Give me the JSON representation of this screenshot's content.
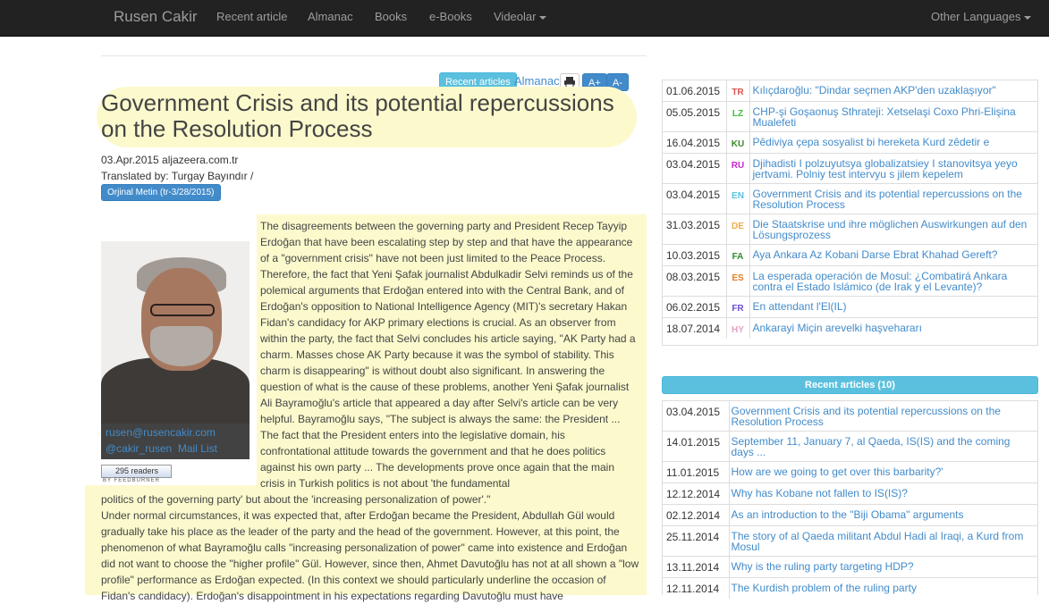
{
  "nav": {
    "brand": "Rusen Cakir",
    "items": [
      "Recent article",
      "Almanac",
      "Books",
      "e-Books",
      "Videolar"
    ],
    "other_languages": "Other Languages"
  },
  "toolbar": {
    "recent_articles": "Recent articles",
    "almanac": "Almanac",
    "print_icon": "print-icon",
    "font_increase": "A+",
    "font_decrease": "A-"
  },
  "article": {
    "title": "Government Crisis and its potential repercussions on the Resolution Process",
    "date_source": "03.Apr.2015 aljazeera.com.tr",
    "translated_by": "Translated by: Turgay Bayındır /",
    "original_button": "Orjinal Metin (tr-3/28/2015)",
    "para1": "The disagreements between the governing party and President Recep Tayyip Erdoğan that have been escalating step by step and that have the appearance of a \"government crisis\" have not been just limited to the Peace Process. Therefore, the fact that Yeni Şafak journalist Abdulkadir Selvi reminds us of the polemical arguments that Erdoğan entered into with the Central Bank, and of Erdoğan's opposition to National Intelligence Agency (MIT)'s secretary Hakan Fidan's candidacy for AKP primary elections is crucial. As an observer from within the party, the fact that Selvi concludes his article saying, \"AK Party had a charm. Masses chose AK Party because it was the symbol of stability. This charm is disappearing\" is without doubt also significant. In answering the question of what is the cause of these problems, another Yeni Şafak journalist Ali Bayramoğlu's article that appeared a day after Selvi's article can be very helpful. Bayramoğlu says, \"The subject is always the same: the President ... The fact that the President enters into the legislative domain, his confrontational attitude towards the government and that he does politics against his own party ... The developments prove once again that the main crisis in Turkish politics is not about 'the fundamental",
    "para1_end": "politics of the governing party' but about the 'increasing personalization of power'.\"",
    "para2": "Under normal circumstances, it was expected that, after Erdoğan became the President, Abdullah Gül would gradually take his place as the leader of the party and the head of the government. However, at this point, the phenomenon of what Bayramoğlu calls \"increasing personalization of power\" came into existence and Erdoğan did not want to choose the \"higher profile\" Gül. However, since then, Ahmet Davutoğlu has not at all shown a \"low profile\" performance as Erdoğan expected. (In this context we should particularly underline the occasion of Fidan's candidacy). Erdoğan's disappointment in his expectations regarding Davutoğlu must have"
  },
  "author": {
    "email": "rusen@rusencakir.com",
    "twitter": "@cakir_rusen",
    "mail_list": "Mail List",
    "feed_count": "295 readers",
    "feed_label": "BY FEEDBURNER"
  },
  "translations": [
    {
      "date": "01.06.2015",
      "lang": "TR",
      "color": "#d9534f",
      "title": "Kılıçdaroğlu: \"Dindar seçmen AKP'den uzaklaşıyor\""
    },
    {
      "date": "05.05.2015",
      "lang": "LZ",
      "color": "#3dbf3d",
      "title": "CHP-şi Goşaonuş Sthrateji: Xetselaşi Coxo Phri-Elişina Mualefeti"
    },
    {
      "date": "16.04.2015",
      "lang": "KU",
      "color": "#3c8a2e",
      "title": "Pêdiviya çepa sosyalist bi hereketa Kurd zêdetir e"
    },
    {
      "date": "03.04.2015",
      "lang": "RU",
      "color": "#c62bd0",
      "title": "Djihadisti I polzuyutsya globalizatsiey I stanovitsya yeyo jertvami. Polniy test intervyu s jilem kepelem"
    },
    {
      "date": "03.04.2015",
      "lang": "EN",
      "color": "#5bc0de",
      "title": "Government Crisis and its potential repercussions on the Resolution Process"
    },
    {
      "date": "31.03.2015",
      "lang": "DE",
      "color": "#f0ad4e",
      "title": "Die Staatskrise und ihre möglichen Auswirkungen auf den Lösungsprozess"
    },
    {
      "date": "10.03.2015",
      "lang": "FA",
      "color": "#2e8b2e",
      "title": "Aya Ankara Az Kobani Darse Ebrat Khahad Gereft?"
    },
    {
      "date": "08.03.2015",
      "lang": "ES",
      "color": "#e67e22",
      "title": "La esperada operación de Mosul: ¿Combatirá Ankara contra el Estado Islámico (de Irak y el Levante)?"
    },
    {
      "date": "06.02.2015",
      "lang": "FR",
      "color": "#6a4fcf",
      "title": "En attendant l'El(IL)"
    },
    {
      "date": "18.07.2014",
      "lang": "HY",
      "color": "#e3a3c5",
      "title": "Ankarayi Miçin arevelki haşvehararı"
    }
  ],
  "recent": {
    "heading": "Recent articles (10)",
    "items": [
      {
        "date": "03.04.2015",
        "title": "Government Crisis and its potential repercussions on the Resolution Process"
      },
      {
        "date": "14.01.2015",
        "title": "September 11, January 7, al Qaeda, IS(IS) and the coming days ..."
      },
      {
        "date": "11.01.2015",
        "title": "How are we going to get over this barbarity?'"
      },
      {
        "date": "12.12.2014",
        "title": "Why has Kobane not fallen to IS(IS)?"
      },
      {
        "date": "02.12.2014",
        "title": "As an introduction to the \"Biji Obama\" arguments"
      },
      {
        "date": "25.11.2014",
        "title": "The story of al Qaeda militant Abdul Hadi al Iraqi, a Kurd from Mosul"
      },
      {
        "date": "13.11.2014",
        "title": "Why is the ruling party targeting HDP?"
      },
      {
        "date": "12.11.2014",
        "title": "The Kurdish problem of the ruling party"
      }
    ]
  }
}
